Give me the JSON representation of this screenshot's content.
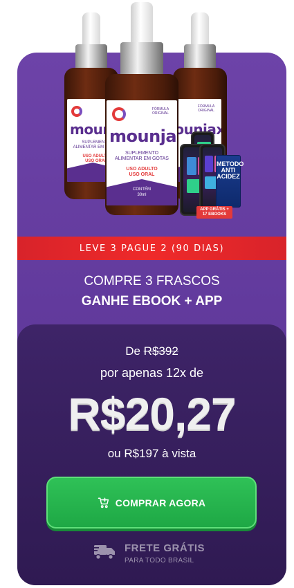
{
  "product": {
    "brand": "mounjax",
    "label_line1": "SUPLEMENTO",
    "label_line2": "ALIMENTAR EM GOTAS",
    "label_use1": "USO ADULTO",
    "label_use2": "USO ORAL",
    "label_content1": "CONTÉM",
    "label_content2": "30ml",
    "formula1": "FÓRMULA",
    "formula2": "ORIGINAL",
    "ebook_text": "METODO ANTI ACIDEZ",
    "app_tag": "APP GRÁTIS + 17 EBOOKS"
  },
  "banner": {
    "text": "LEVE 3 PAGUE 2 (90 DIAS)"
  },
  "headline": {
    "line1": "COMPRE 3 FRASCOS",
    "line2": "GANHE EBOOK + APP"
  },
  "pricing": {
    "de_prefix": "De",
    "old_price": "R$392",
    "installments": "por apenas 12x de",
    "price": "R$20,27",
    "cash": "ou R$197 à vista"
  },
  "cta": {
    "label": "COMPRAR AGORA"
  },
  "shipping": {
    "title": "FRETE GRÁTIS",
    "subtitle": "PARA TODO BRASIL"
  },
  "colors": {
    "card": "#6a3fa3",
    "banner": "#e52a2a",
    "panel": "#2f1a52",
    "cta": "#22b04b"
  }
}
